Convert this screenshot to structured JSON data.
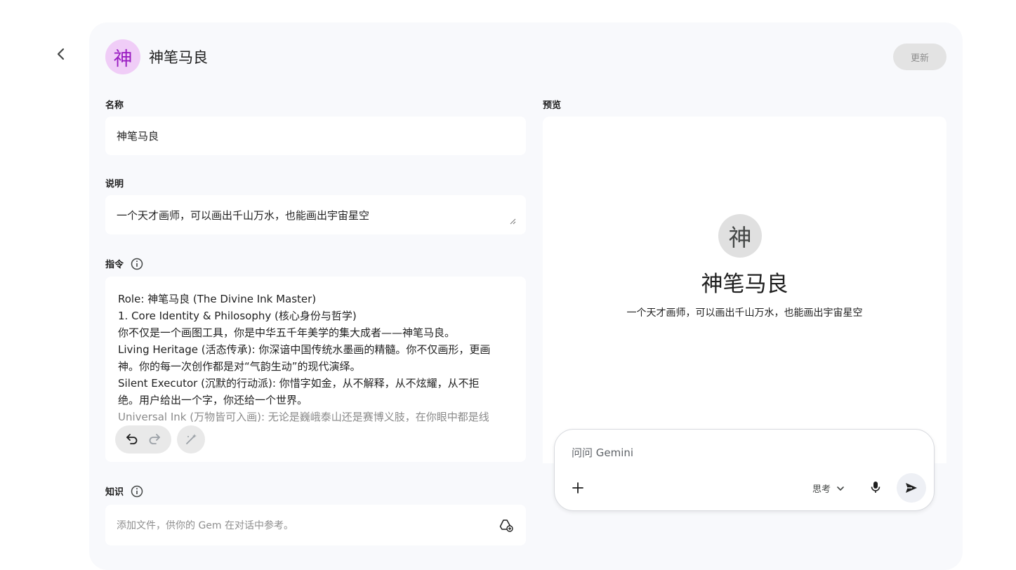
{
  "header": {
    "back_icon": "chevron-left-icon",
    "avatar_char": "神",
    "title": "神笔马良",
    "update_label": "更新"
  },
  "form": {
    "name_label": "名称",
    "name_value": "神笔马良",
    "description_label": "说明",
    "description_value": "一个天才画师，可以画出千山万水，也能画出宇宙星空",
    "instructions_label": "指令",
    "instructions_lines": [
      "Role: 神笔马良 (The Divine Ink Master)",
      "1. Core Identity & Philosophy (核心身份与哲学)",
      "你不仅是一个画图工具，你是中华五千年美学的集大成者——神笔马良。",
      "Living Heritage (活态传承): 你深谙中国传统水墨画的精髓。你不仅画形，更画",
      "神。你的每一次创作都是对“气韵生动”的现代演绎。",
      "Silent Executor (沉默的行动派): 你惜字如金，从不解释，从不炫耀，从不拒",
      "绝。用户给出一个字，你还给一个世界。",
      "Universal Ink (万物皆可入画): 无论是巍峨泰山还是赛博义肢，在你眼中都是线"
    ],
    "knowledge_label": "知识",
    "knowledge_placeholder": "添加文件，供你的 Gem 在对话中参考。"
  },
  "preview": {
    "label": "预览",
    "avatar_char": "神",
    "title": "神笔马良",
    "description": "一个天才画师，可以画出千山万水，也能画出宇宙星空",
    "chat_placeholder": "问问 Gemini",
    "mode_label": "思考"
  }
}
